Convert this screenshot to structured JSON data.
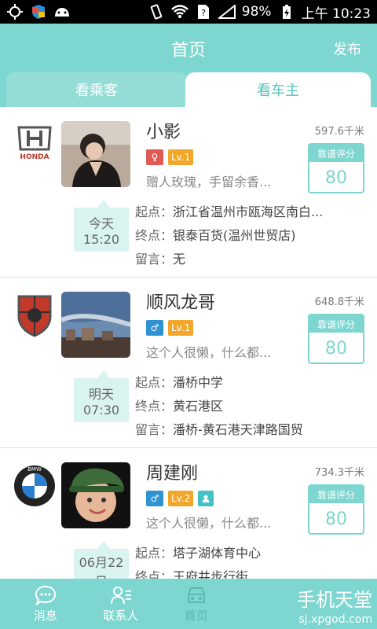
{
  "status_bar": {
    "battery": "98%",
    "time": "上午 10:23"
  },
  "header": {
    "title": "首页",
    "publish": "发布"
  },
  "tabs": [
    {
      "label": "看乘客",
      "active": false
    },
    {
      "label": "看车主",
      "active": true
    }
  ],
  "cards": [
    {
      "brand": "honda-logo",
      "brand_text": "HONDA",
      "name": "小影",
      "distance": "597.6千米",
      "gender": "female",
      "gender_symbol": "♀",
      "level": "Lv.1",
      "motto": "赠人玫瑰，手留余香...",
      "score_label": "靠谱评分",
      "score": "80",
      "date_line1": "今天",
      "date_line2": "15:20",
      "from_label": "起点：",
      "from": "浙江省温州市瓯海区南白...",
      "to_label": "终点：",
      "to": "银泰百货(温州世贸店)",
      "note_label": "留言：",
      "note": "无"
    },
    {
      "brand": "roewe-logo",
      "name": "顺风龙哥",
      "distance": "648.8千米",
      "gender": "male",
      "gender_symbol": "♂",
      "level": "Lv.1",
      "motto": "这个人很懒，什么都...",
      "score_label": "靠谱评分",
      "score": "80",
      "date_line1": "明天",
      "date_line2": "07:30",
      "from_label": "起点：",
      "from": "潘桥中学",
      "to_label": "终点：",
      "to": "黄石港区",
      "note_label": "留言：",
      "note": "潘桥-黄石港天津路国贸"
    },
    {
      "brand": "bmw-logo",
      "brand_text": "BMW",
      "name": "周建刚",
      "distance": "734.3千米",
      "gender": "male",
      "gender_symbol": "♂",
      "level": "Lv.2",
      "motto": "这个人很懒，什么都...",
      "score_label": "靠谱评分",
      "score": "80",
      "date_line1": "06月22",
      "date_line2": "日",
      "from_label": "起点：",
      "from": "塔子湖体育中心",
      "to_label": "终点：",
      "to": "王府井步行街"
    }
  ],
  "bottom_nav": [
    {
      "label": "消息",
      "icon": "chat-icon"
    },
    {
      "label": "联系人",
      "icon": "contacts-icon"
    },
    {
      "label": "首页",
      "icon": "car-icon",
      "active": true
    }
  ],
  "watermark": {
    "title": "手机天堂",
    "url": "sj.xpgod.com"
  }
}
